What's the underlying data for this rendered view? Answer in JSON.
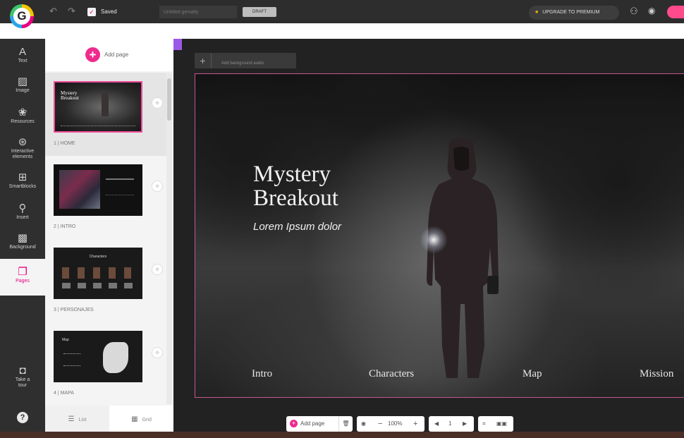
{
  "topbar": {
    "logo_letter": "G",
    "saved_label": "Saved",
    "title_placeholder": "Untitled genially",
    "draft_label": "DRAFT",
    "upgrade_label": "UPGRADE TO PREMIUM"
  },
  "leftnav": {
    "items": [
      {
        "label": "Text",
        "icon": "text-icon"
      },
      {
        "label": "Image",
        "icon": "image-icon"
      },
      {
        "label": "Resources",
        "icon": "resources-icon"
      },
      {
        "label": "Interactive elements",
        "icon": "interactive-icon"
      },
      {
        "label": "Smartblocks",
        "icon": "smartblocks-icon"
      },
      {
        "label": "Insert",
        "icon": "insert-icon"
      },
      {
        "label": "Background",
        "icon": "background-icon"
      },
      {
        "label": "Pages",
        "icon": "pages-icon"
      },
      {
        "label": "Take a tour",
        "icon": "tour-icon"
      }
    ],
    "help_glyph": "?"
  },
  "pages_panel": {
    "add_page_label": "Add page",
    "pages": [
      {
        "label": "1 | HOME",
        "thumb_title": "Mystery Breakout"
      },
      {
        "label": "2 | INTRO",
        "thumb_title": ""
      },
      {
        "label": "3 | PERSONAJES",
        "thumb_title": "Characters"
      },
      {
        "label": "4 | MAPA",
        "thumb_title": "Map"
      }
    ],
    "list_label": "List",
    "grid_label": "Grid"
  },
  "canvas": {
    "bg_audio_label": "Add background audio",
    "slide_title": "Mystery\nBreakout",
    "slide_subtitle": "Lorem Ipsum dolor",
    "menu": [
      "Intro",
      "Characters",
      "Map",
      "Mission"
    ]
  },
  "bottom_toolbar": {
    "add_page_label": "Add page",
    "zoom_label": "100%",
    "page_number": "1"
  },
  "colors": {
    "accent": "#ee2b8c",
    "topbar": "#2d2d2d",
    "nav": "#2f2f2f"
  }
}
